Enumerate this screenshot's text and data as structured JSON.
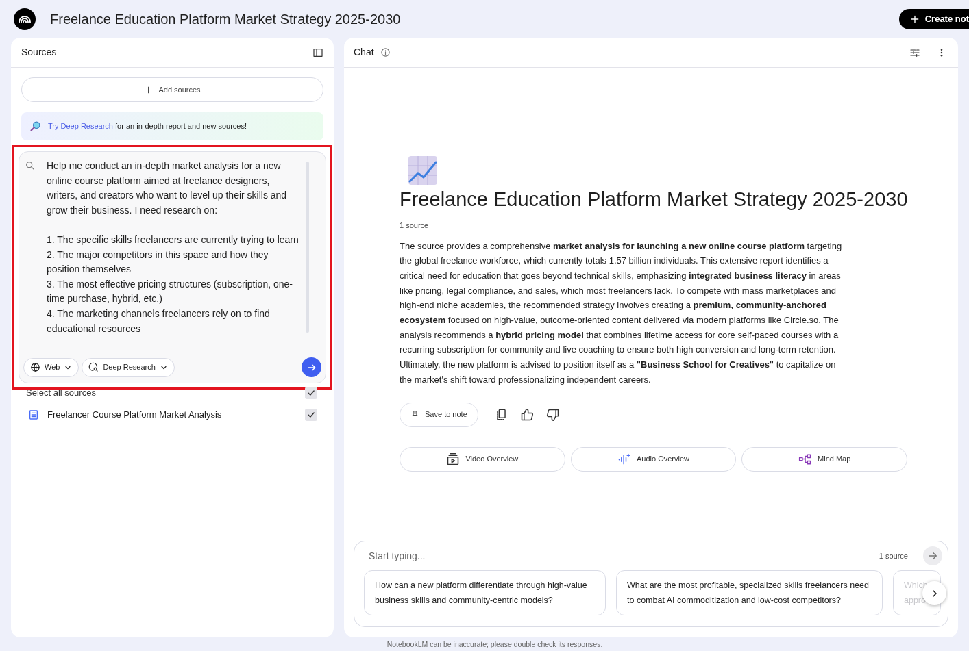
{
  "header": {
    "title": "Freelance Education Platform Market Strategy 2025-2030",
    "create_button": "Create not"
  },
  "sources": {
    "title": "Sources",
    "add_button": "Add sources",
    "banner": {
      "link": "Try Deep Research",
      "text": "for an in-depth report and new sources!"
    },
    "prompt": {
      "value": "Help me conduct an in-depth market analysis for a new online course platform aimed at freelance designers, writers, and creators who want to level up their skills and grow their business. I need research on:\n\n1. The specific skills freelancers are currently trying to learn\n2. The major competitors in this space and how they position themselves\n3. The most effective pricing structures (subscription, one-time purchase, hybrid, etc.)\n4. The marketing channels freelancers rely on to find educational resources",
      "chips": [
        "Web",
        "Deep Research"
      ]
    },
    "select_all": {
      "label": "Select all sources",
      "checked": true
    },
    "items": [
      {
        "label": "Freelancer Course Platform Market Analysis",
        "checked": true
      }
    ]
  },
  "chat": {
    "title": "Chat",
    "notebook_title": "Freelance Education Platform Market Strategy 2025-2030",
    "source_count": "1 source",
    "summary": "The source provides a comprehensive **market analysis for launching a new online course platform** targeting the global freelance workforce, which currently totals 1.57 billion individuals. This extensive report identifies a critical need for education that goes beyond technical skills, emphasizing **integrated business literacy** in areas like pricing, legal compliance, and sales, which most freelancers lack. To compete with mass marketplaces and high-end niche academies, the recommended strategy involves creating a **premium, community-anchored ecosystem** focused on high-value, outcome-oriented content delivered via modern platforms like Circle.so. The analysis recommends a **hybrid pricing model** that combines lifetime access for core self-paced courses with a recurring subscription for community and live coaching to ensure both high conversion and long-term retention. Ultimately, the new platform is advised to position itself as a **\"Business School for Creatives\"** to capitalize on the market's shift toward professionalizing independent careers.",
    "save_button": "Save to note",
    "overviews": [
      {
        "kind": "video",
        "label": "Video Overview"
      },
      {
        "kind": "audio",
        "label": "Audio Overview"
      },
      {
        "kind": "mindmap",
        "label": "Mind Map"
      }
    ],
    "input": {
      "placeholder": "Start typing...",
      "source_count": "1 source"
    },
    "suggestions": [
      "How can a new platform differentiate through high-value business skills and community-centric models?",
      "What are the most profitable, specialized skills freelancers need to combat AI commoditization and low-cost competitors?",
      "Which appro"
    ]
  },
  "footer": "NotebookLM can be inaccurate; please double check its responses."
}
